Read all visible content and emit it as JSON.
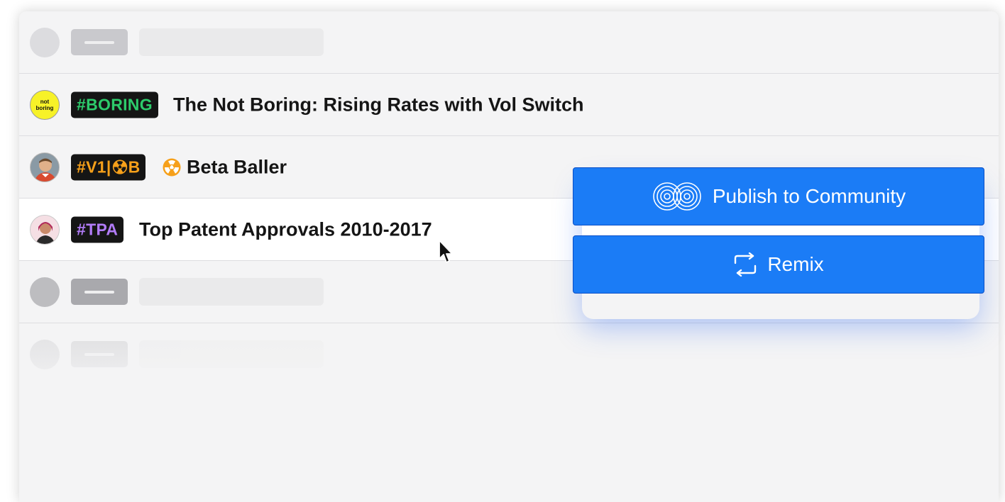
{
  "rows": [
    {
      "kind": "skeleton"
    },
    {
      "kind": "item",
      "avatar": {
        "text_line1": "not",
        "text_line2": "boring",
        "icon": "not-boring-logo"
      },
      "tag": "#BORING",
      "tag_color": "#2dcb6b",
      "title": "The Not Boring: Rising Rates with Vol Switch"
    },
    {
      "kind": "item",
      "avatar": {
        "icon": "person-photo-avatar"
      },
      "tag_prefix": "#V1|",
      "tag_suffix": "B",
      "tag_color": "#f6a01a",
      "title_emoji": "radioactive-icon",
      "title": "Beta Baller"
    },
    {
      "kind": "item",
      "avatar": {
        "icon": "person-photo-avatar"
      },
      "tag": "#TPA",
      "tag_color": "#b27cf8",
      "title": "Top Patent Approvals 2010-2017"
    },
    {
      "kind": "skeleton"
    },
    {
      "kind": "skeleton"
    }
  ],
  "actions": {
    "publish_label": "Publish to Community",
    "publish_icon": "community-rings-icon",
    "remix_label": "Remix",
    "remix_icon": "swap-arrows-icon",
    "button_color": "#1b7cf6"
  }
}
